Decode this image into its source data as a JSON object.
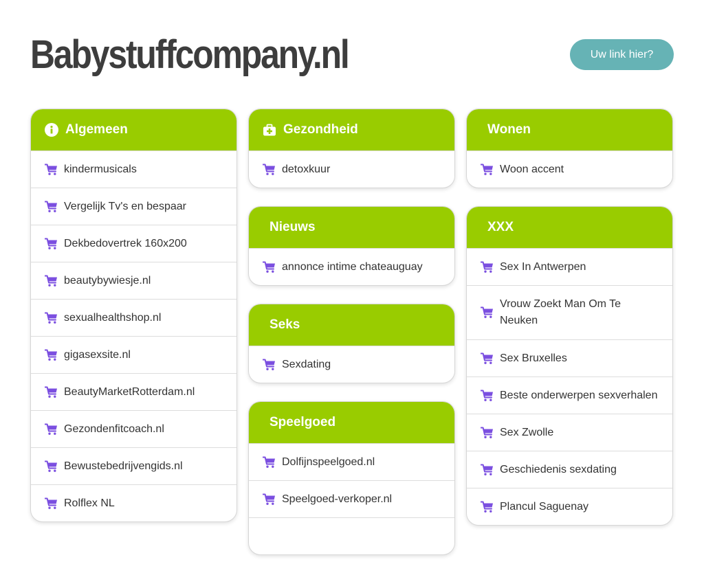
{
  "site": {
    "title": "Babystuffcompany.nl",
    "cta_label": "Uw link hier?"
  },
  "colors": {
    "accent_green": "#99cc00",
    "cta_teal": "#66b3b5",
    "cart_purple": "#7b4fe0",
    "title_gray": "#3d3d3d"
  },
  "cards": {
    "algemeen": {
      "title": "Algemeen",
      "icon": "info-icon",
      "links": [
        "kindermusicals",
        "Vergelijk Tv's en bespaar",
        "Dekbedovertrek 160x200",
        "beautybywiesje.nl",
        "sexualhealthshop.nl",
        "gigasexsite.nl",
        "BeautyMarketRotterdam.nl",
        "Gezondenfitcoach.nl",
        "Bewustebedrijvengids.nl",
        "Rolflex NL"
      ]
    },
    "gezondheid": {
      "title": "Gezondheid",
      "icon": "medkit-icon",
      "links": [
        "detoxkuur"
      ]
    },
    "nieuws": {
      "title": "Nieuws",
      "links": [
        "annonce intime chateauguay"
      ]
    },
    "seks": {
      "title": "Seks",
      "links": [
        "Sexdating"
      ]
    },
    "speelgoed": {
      "title": "Speelgoed",
      "links": [
        "Dolfijnspeelgoed.nl",
        "Speelgoed-verkoper.nl"
      ]
    },
    "wonen": {
      "title": "Wonen",
      "links": [
        "Woon accent"
      ]
    },
    "xxx": {
      "title": "XXX",
      "links": [
        "Sex In Antwerpen",
        "Vrouw Zoekt Man Om Te Neuken",
        "Sex Bruxelles",
        "Beste onderwerpen sexverhalen",
        "Sex Zwolle",
        "Geschiedenis sexdating",
        "Plancul Saguenay"
      ]
    }
  },
  "link_icon": "shopping-cart-icon"
}
